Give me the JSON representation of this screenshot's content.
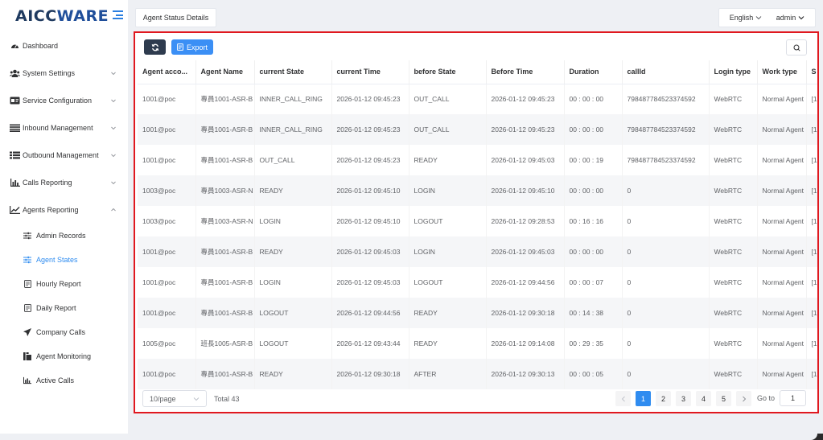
{
  "brand": {
    "logo_main": "AICC",
    "logo_accent": "WARE"
  },
  "sidebar": {
    "items": [
      {
        "label": "Dashboard",
        "icon": "dashboard-icon"
      },
      {
        "label": "System Settings",
        "icon": "users-icon"
      },
      {
        "label": "Service Configuration",
        "icon": "id-card-icon"
      },
      {
        "label": "Inbound Management",
        "icon": "list-icon"
      },
      {
        "label": "Outbound Management",
        "icon": "list-ul-icon"
      },
      {
        "label": "Calls Reporting",
        "icon": "bar-chart-icon"
      },
      {
        "label": "Agents Reporting",
        "icon": "line-chart-icon"
      }
    ],
    "sub_items": [
      {
        "label": "Admin Records",
        "icon": "sliders-icon"
      },
      {
        "label": "Agent States",
        "icon": "sliders-icon",
        "active": true
      },
      {
        "label": "Hourly Report",
        "icon": "document-icon"
      },
      {
        "label": "Daily Report",
        "icon": "document-icon"
      },
      {
        "label": "Company Calls",
        "icon": "send-icon"
      },
      {
        "label": "Agent Monitoring",
        "icon": "monitor-icon"
      },
      {
        "label": "Active Calls",
        "icon": "bar-chart-icon"
      }
    ]
  },
  "header": {
    "tab_label": "Agent Status Details",
    "language": "English",
    "user": "admin"
  },
  "toolbar": {
    "export_label": "Export"
  },
  "table": {
    "columns": [
      "Agent acco...",
      "Agent Name",
      "current State",
      "current Time",
      "before State",
      "Before Time",
      "Duration",
      "callId",
      "Login type",
      "Work type",
      "S"
    ],
    "rows": [
      [
        "1001@poc",
        "專員1001-ASR-B",
        "INNER_CALL_RING",
        "2026-01-12 09:45:23",
        "OUT_CALL",
        "2026-01-12 09:45:23",
        "00 : 00 : 00",
        "798487784523374592",
        "WebRTC",
        "Normal Agent",
        "[1"
      ],
      [
        "1001@poc",
        "專員1001-ASR-B",
        "INNER_CALL_RING",
        "2026-01-12 09:45:23",
        "OUT_CALL",
        "2026-01-12 09:45:23",
        "00 : 00 : 00",
        "798487784523374592",
        "WebRTC",
        "Normal Agent",
        "[1"
      ],
      [
        "1001@poc",
        "專員1001-ASR-B",
        "OUT_CALL",
        "2026-01-12 09:45:23",
        "READY",
        "2026-01-12 09:45:03",
        "00 : 00 : 19",
        "798487784523374592",
        "WebRTC",
        "Normal Agent",
        "[1"
      ],
      [
        "1003@poc",
        "專員1003-ASR-N",
        "READY",
        "2026-01-12 09:45:10",
        "LOGIN",
        "2026-01-12 09:45:10",
        "00 : 00 : 00",
        "0",
        "WebRTC",
        "Normal Agent",
        "[1"
      ],
      [
        "1003@poc",
        "專員1003-ASR-N",
        "LOGIN",
        "2026-01-12 09:45:10",
        "LOGOUT",
        "2026-01-12 09:28:53",
        "00 : 16 : 16",
        "0",
        "WebRTC",
        "Normal Agent",
        "[1"
      ],
      [
        "1001@poc",
        "專員1001-ASR-B",
        "READY",
        "2026-01-12 09:45:03",
        "LOGIN",
        "2026-01-12 09:45:03",
        "00 : 00 : 00",
        "0",
        "WebRTC",
        "Normal Agent",
        "[1"
      ],
      [
        "1001@poc",
        "專員1001-ASR-B",
        "LOGIN",
        "2026-01-12 09:45:03",
        "LOGOUT",
        "2026-01-12 09:44:56",
        "00 : 00 : 07",
        "0",
        "WebRTC",
        "Normal Agent",
        "[1"
      ],
      [
        "1001@poc",
        "專員1001-ASR-B",
        "LOGOUT",
        "2026-01-12 09:44:56",
        "READY",
        "2026-01-12 09:30:18",
        "00 : 14 : 38",
        "0",
        "WebRTC",
        "Normal Agent",
        "[1"
      ],
      [
        "1005@poc",
        "班長1005-ASR-B",
        "LOGOUT",
        "2026-01-12 09:43:44",
        "READY",
        "2026-01-12 09:14:08",
        "00 : 29 : 35",
        "0",
        "WebRTC",
        "Normal Agent",
        "[1"
      ],
      [
        "1001@poc",
        "專員1001-ASR-B",
        "READY",
        "2026-01-12 09:30:18",
        "AFTER",
        "2026-01-12 09:30:13",
        "00 : 00 : 05",
        "0",
        "WebRTC",
        "Normal Agent",
        "[1"
      ]
    ]
  },
  "pagination": {
    "page_size": "10/page",
    "total": "Total 43",
    "pages": [
      "1",
      "2",
      "3",
      "4",
      "5"
    ],
    "current_page": "1",
    "goto_label": "Go to",
    "goto_value": "1"
  },
  "colors": {
    "accent": "#2f8cf0",
    "highlight_border": "#e0181f",
    "dark_button": "#2e3b4e"
  }
}
